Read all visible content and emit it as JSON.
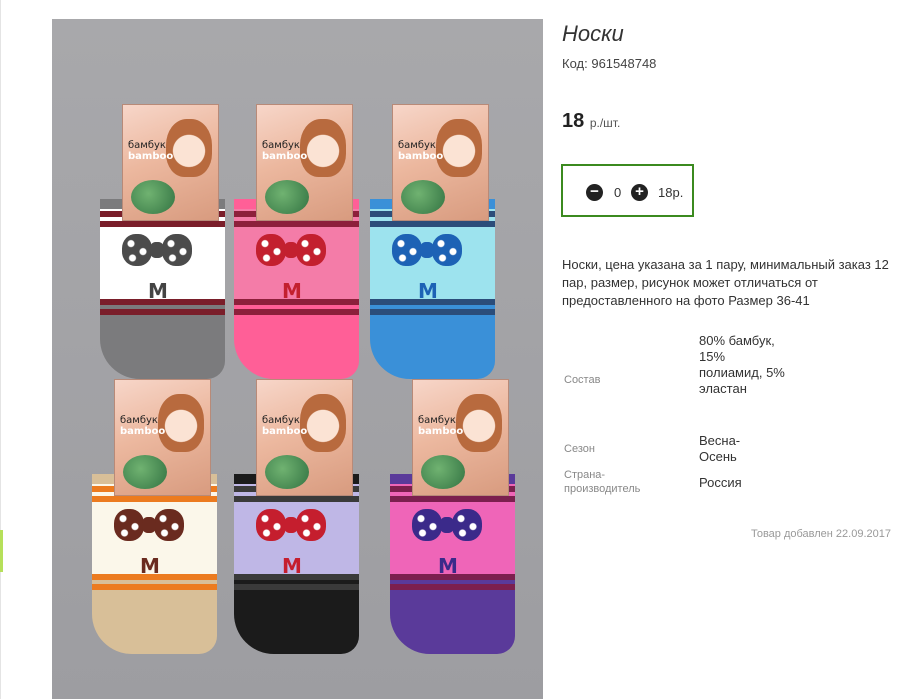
{
  "product": {
    "title": "Носки",
    "code_label": "Код:",
    "code_value": "961548748",
    "price_value": "18",
    "price_unit": "р./шт.",
    "quantity": {
      "minus_symbol": "−",
      "plus_symbol": "+",
      "value": "0",
      "sum": "18р."
    },
    "description": "Носки, цена указана за 1 пару, минимальный заказ 12 пар, размер, рисунок может отличаться от предоставленного на фото Размер 36-41",
    "properties": [
      {
        "label": "Состав",
        "value": "80% бамбук, 15% полиамид, 5% эластан"
      },
      {
        "label": "Сезон",
        "value": "Весна-Осень"
      },
      {
        "label": "Страна-производитель",
        "value": "Россия"
      }
    ],
    "added_text": "Товар добавлен 22.09.2017"
  },
  "photo": {
    "card_text_line1": "бамбук",
    "card_text_line2": "bamboo",
    "sock_letter": "M",
    "socks": [
      {
        "body": "#ffffff",
        "stripe": "#7a1e2a",
        "heel": "#7b7b7d",
        "bow": "#4b4b4b",
        "letter": "#444"
      },
      {
        "body": "#f47ca8",
        "stripe": "#8d1f3b",
        "heel": "#ff5f97",
        "bow": "#c3202f",
        "letter": "#c3202f"
      },
      {
        "body": "#9de3ee",
        "stripe": "#2b4d7a",
        "heel": "#3a90d8",
        "bow": "#1d62b5",
        "letter": "#1d62b5"
      },
      {
        "body": "#fbf7ea",
        "stripe": "#ec7b1f",
        "heel": "#d8bf98",
        "bow": "#6a2b1f",
        "letter": "#6a2b1f"
      },
      {
        "body": "#bfb7e6",
        "stripe": "#3a3a3a",
        "heel": "#1b1b1b",
        "bow": "#c51e2e",
        "letter": "#c51e2e"
      },
      {
        "body": "#ef65b8",
        "stripe": "#7c1f4e",
        "heel": "#5a3a9a",
        "bow": "#3b2a8a",
        "letter": "#3b2a8a"
      }
    ]
  },
  "colors": {
    "qty_border": "#3b8a1f",
    "photo_bg": "#a3a3a7"
  }
}
